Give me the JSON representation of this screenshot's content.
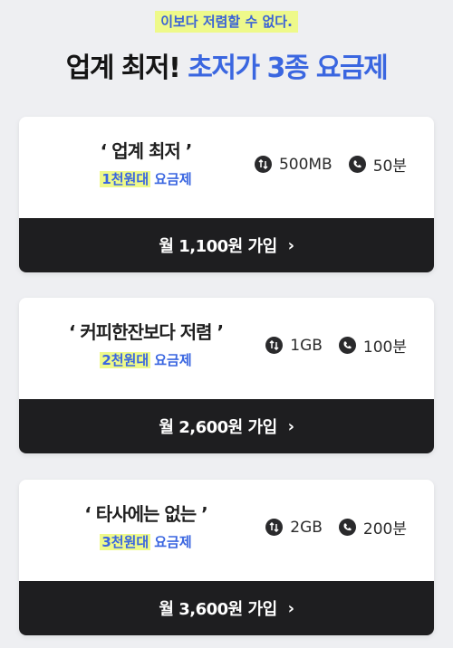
{
  "header": {
    "tagline": "이보다 저렴할 수 없다.",
    "headline_black": "업계 최저!",
    "headline_blue": "초저가 3종 요금제"
  },
  "plans": [
    {
      "name": "‘ 업계 최저 ’",
      "tier_highlight": "1천원대",
      "tier_suffix": "요금제",
      "data": "500MB",
      "voice": "50분",
      "cta": "월 1,100원 가입"
    },
    {
      "name": "‘ 커피한잔보다 저렴 ’",
      "tier_highlight": "2천원대",
      "tier_suffix": "요금제",
      "data": "1GB",
      "voice": "100분",
      "cta": "월 2,600원 가입"
    },
    {
      "name": "‘ 타사에는 없는 ’",
      "tier_highlight": "3천원대",
      "tier_suffix": "요금제",
      "data": "2GB",
      "voice": "200분",
      "cta": "월 3,600원 가입"
    }
  ],
  "icons": {
    "data": "data-transfer-icon",
    "voice": "phone-icon",
    "cta_arrow": "chevron-right-icon"
  },
  "colors": {
    "accent_blue": "#3a66e0",
    "highlight_yellow": "#eef98a",
    "cta_bg": "#1e1e20",
    "page_bg": "#eeeff2"
  }
}
